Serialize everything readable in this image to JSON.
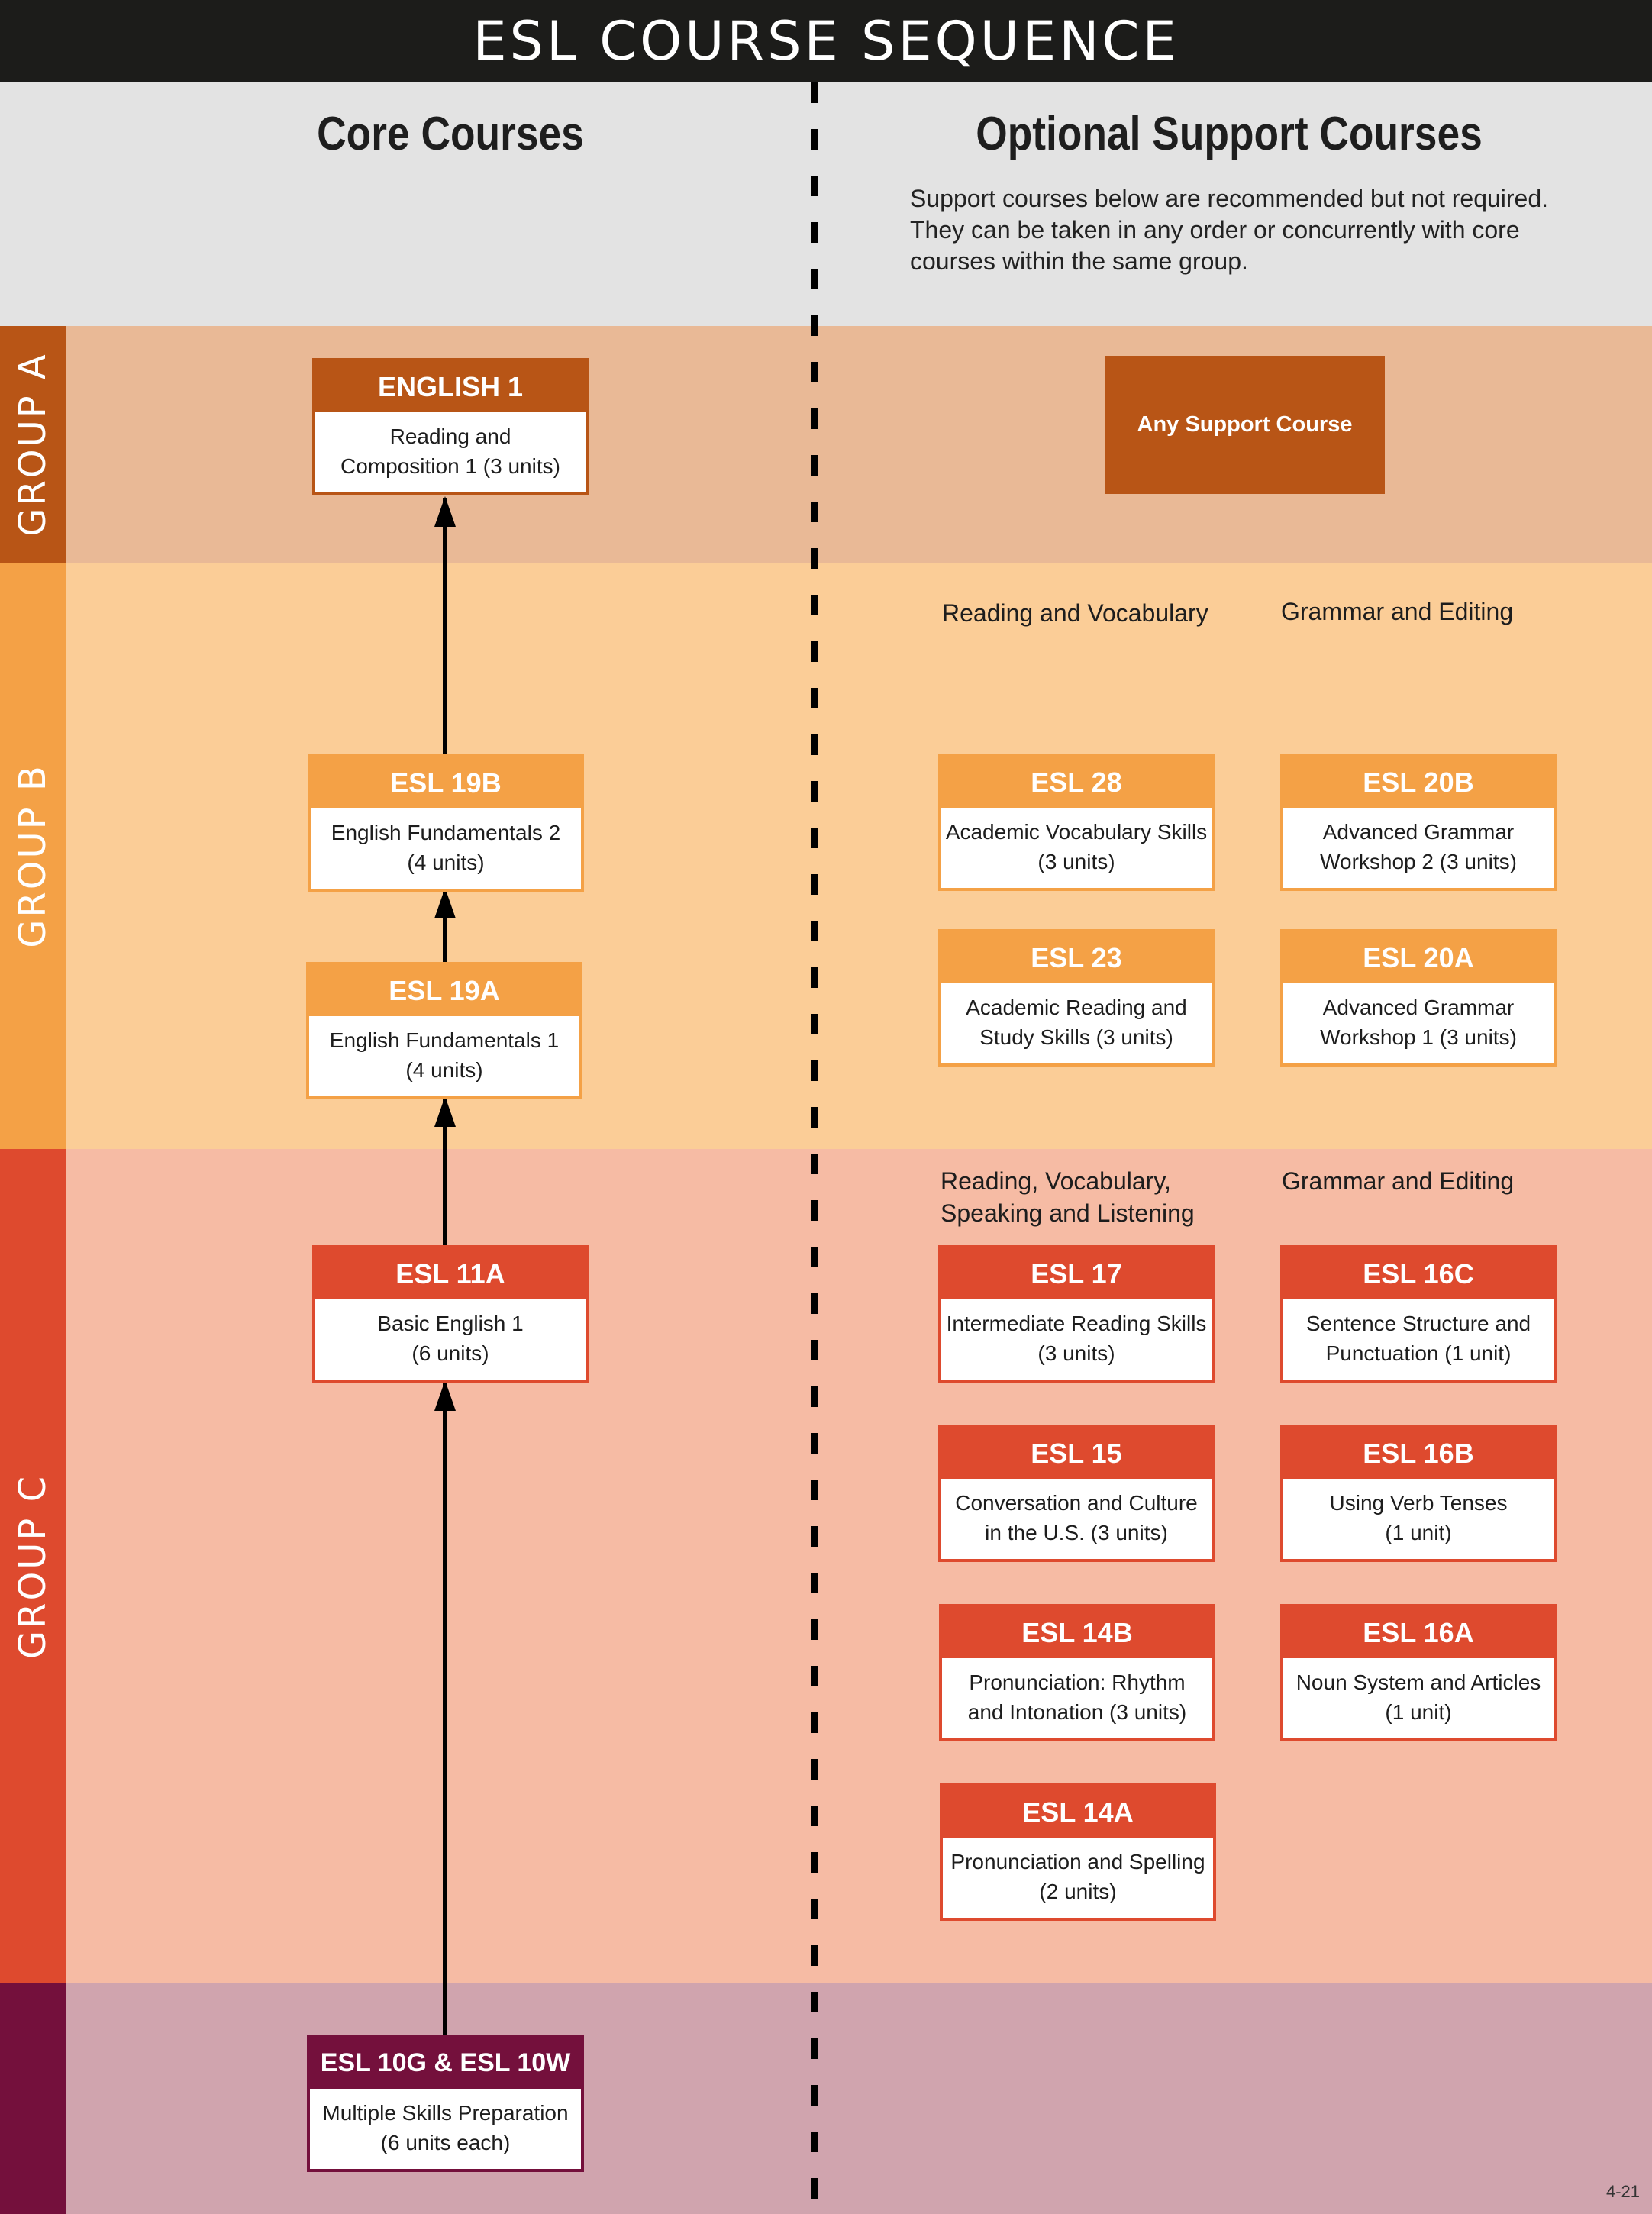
{
  "header": {
    "title": "ESL COURSE SEQUENCE"
  },
  "intro": {
    "core_heading": "Core Courses",
    "optional_heading": "Optional Support Courses",
    "description": "Support courses below are recommended but not required. They can be taken in any order or concurrently with core courses within the same group."
  },
  "colors": {
    "header_bg": "#1c1c1a",
    "intro_bg": "#e3e3e3",
    "group_a": "#b85516",
    "group_a_bg": "#e9b996",
    "group_b": "#f4a146",
    "group_b_bg": "#fbcd97",
    "group_c": "#de4a2e",
    "group_c_bg": "#f6bba4",
    "foundation": "#74103c",
    "foundation_bg": "#d0a4ae"
  },
  "groups": {
    "a": {
      "label": "GROUP A",
      "core": {
        "code": "ENGLISH 1",
        "desc_line1": "Reading and",
        "desc_line2": "Composition 1 (3 units)"
      },
      "support_any": "Any Support Course"
    },
    "b": {
      "label": "GROUP B",
      "core": [
        {
          "code": "ESL 19B",
          "desc_line1": "English Fundamentals 2",
          "desc_line2": "(4 units)"
        },
        {
          "code": "ESL 19A",
          "desc_line1": "English Fundamentals 1",
          "desc_line2": "(4 units)"
        }
      ],
      "categories": [
        "Reading and Vocabulary",
        "Grammar and Editing"
      ],
      "support": [
        {
          "code": "ESL 28",
          "desc_line1": "Academic Vocabulary Skills",
          "desc_line2": "(3 units)"
        },
        {
          "code": "ESL 20B",
          "desc_line1": "Advanced Grammar",
          "desc_line2": "Workshop 2 (3 units)"
        },
        {
          "code": "ESL 23",
          "desc_line1": "Academic Reading and",
          "desc_line2": "Study Skills (3 units)"
        },
        {
          "code": "ESL 20A",
          "desc_line1": "Advanced Grammar",
          "desc_line2": "Workshop 1 (3 units)"
        }
      ]
    },
    "c": {
      "label": "GROUP C",
      "core": {
        "code": "ESL 11A",
        "desc_line1": "Basic English 1",
        "desc_line2": "(6 units)"
      },
      "categories": [
        "Reading, Vocabulary,",
        "Speaking and Listening",
        "Grammar and Editing"
      ],
      "support": [
        {
          "code": "ESL 17",
          "desc_line1": "Intermediate Reading Skills",
          "desc_line2": "(3 units)"
        },
        {
          "code": "ESL 16C",
          "desc_line1": "Sentence Structure and",
          "desc_line2": "Punctuation (1 unit)"
        },
        {
          "code": "ESL 15",
          "desc_line1": "Conversation and Culture",
          "desc_line2": "in the U.S. (3 units)"
        },
        {
          "code": "ESL 16B",
          "desc_line1": "Using Verb Tenses",
          "desc_line2": "(1 unit)"
        },
        {
          "code": "ESL 14B",
          "desc_line1": "Pronunciation: Rhythm",
          "desc_line2": "and Intonation (3 units)"
        },
        {
          "code": "ESL 16A",
          "desc_line1": "Noun System and Articles",
          "desc_line2": "(1 unit)"
        },
        {
          "code": "ESL 14A",
          "desc_line1": "Pronunciation and Spelling",
          "desc_line2": "(2 units)"
        }
      ]
    },
    "foundation": {
      "core": {
        "code": "ESL 10G & ESL 10W",
        "desc_line1": "Multiple Skills Preparation",
        "desc_line2": "(6 units each)"
      }
    }
  },
  "footer": {
    "version": "4-21"
  }
}
